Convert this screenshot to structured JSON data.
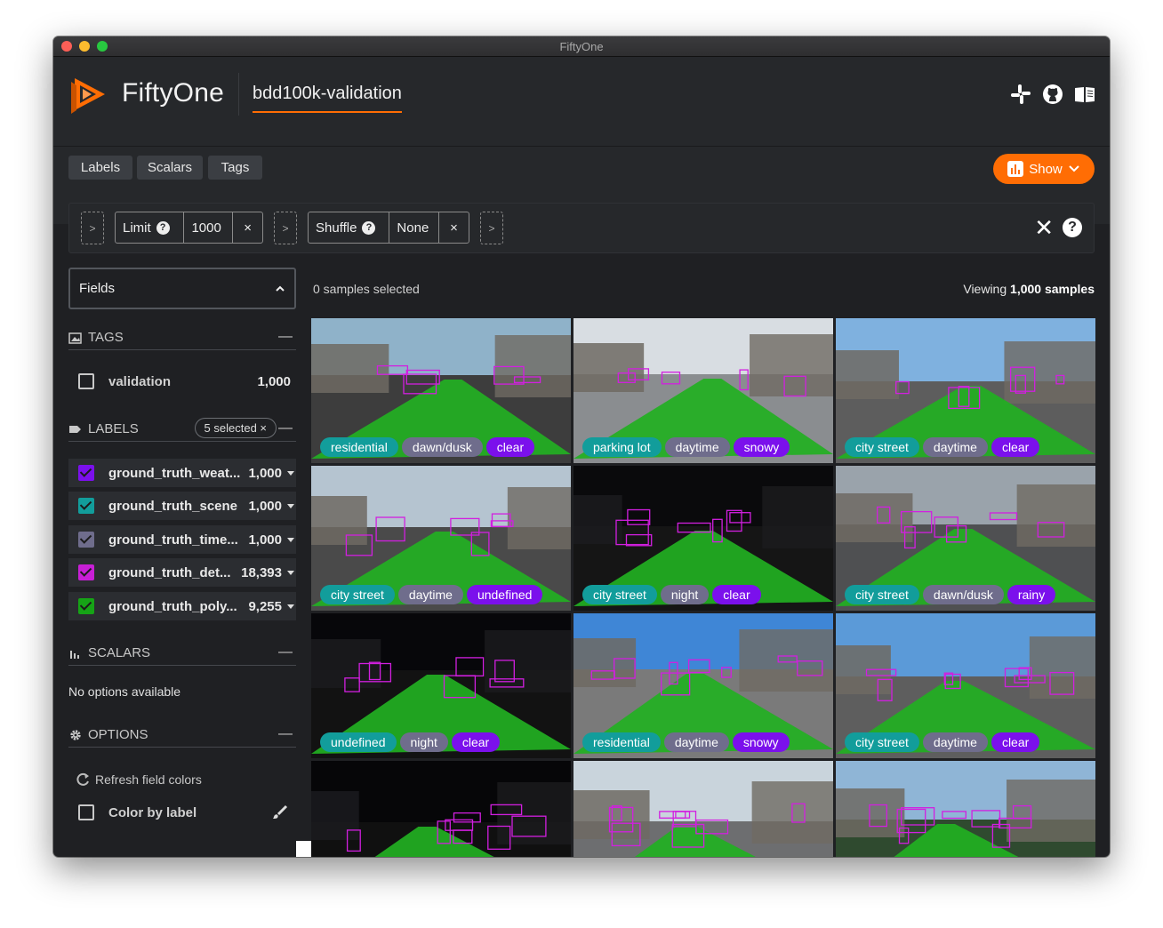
{
  "window": {
    "title": "FiftyOne"
  },
  "header": {
    "brand": "FiftyOne",
    "dataset": "bdd100k-validation",
    "icons": [
      "slack-icon",
      "github-icon",
      "docs-book-icon"
    ]
  },
  "toolbar": {
    "tabs": [
      "Labels",
      "Scalars",
      "Tags"
    ],
    "show_label": "Show"
  },
  "view_bar": {
    "stages": [
      {
        "name": "Limit",
        "value": "1000"
      },
      {
        "name": "Shuffle",
        "value": "None"
      }
    ],
    "add_glyph": ">",
    "remove_glyph": "×"
  },
  "sidebar": {
    "fields_title": "Fields",
    "tags": {
      "title": "TAGS",
      "items": [
        {
          "label": "validation",
          "count": "1,000"
        }
      ]
    },
    "labels": {
      "title": "LABELS",
      "selected_pill": "5 selected ×",
      "items": [
        {
          "label": "ground_truth_weat...",
          "count": "1,000",
          "color": "#7b10ec"
        },
        {
          "label": "ground_truth_scene",
          "count": "1,000",
          "color": "#129d9b"
        },
        {
          "label": "ground_truth_time...",
          "count": "1,000",
          "color": "#6f6d8c"
        },
        {
          "label": "ground_truth_det...",
          "count": "18,393",
          "color": "#c81fd6"
        },
        {
          "label": "ground_truth_poly...",
          "count": "9,255",
          "color": "#16a316"
        }
      ]
    },
    "scalars": {
      "title": "SCALARS",
      "empty": "No options available"
    },
    "options": {
      "title": "OPTIONS",
      "refresh": "Refresh field colors",
      "color_by_label": "Color by label"
    }
  },
  "main": {
    "selected_text": "0 samples selected",
    "viewing_prefix": "Viewing ",
    "viewing_count": "1,000 samples",
    "tiles": [
      {
        "scene": "residential",
        "time": "dawn/dusk",
        "weather": "clear",
        "sky": "#8fb2c9",
        "ground": "#3d3d3d",
        "dark": false
      },
      {
        "scene": "parking lot",
        "time": "daytime",
        "weather": "snowy",
        "sky": "#d8dde2",
        "ground": "#8a8d90",
        "dark": false
      },
      {
        "scene": "city street",
        "time": "daytime",
        "weather": "clear",
        "sky": "#7fb1df",
        "ground": "#5d5d5d",
        "dark": false
      },
      {
        "scene": "city street",
        "time": "daytime",
        "weather": "undefined",
        "sky": "#b5c4d0",
        "ground": "#4a4a4a",
        "dark": false
      },
      {
        "scene": "city street",
        "time": "night",
        "weather": "clear",
        "sky": "#0a0a0c",
        "ground": "#151515",
        "dark": true
      },
      {
        "scene": "city street",
        "time": "dawn/dusk",
        "weather": "rainy",
        "sky": "#9aa3ab",
        "ground": "#4f5052",
        "dark": false
      },
      {
        "scene": "undefined",
        "time": "night",
        "weather": "clear",
        "sky": "#07070a",
        "ground": "#121212",
        "dark": true
      },
      {
        "scene": "residential",
        "time": "daytime",
        "weather": "snowy",
        "sky": "#3f86d6",
        "ground": "#7a7a7a",
        "dark": false
      },
      {
        "scene": "city street",
        "time": "daytime",
        "weather": "clear",
        "sky": "#5b9ad8",
        "ground": "#5e5e5e",
        "dark": false
      },
      {
        "scene": "",
        "time": "",
        "weather": "",
        "sky": "#060608",
        "ground": "#101010",
        "dark": true
      },
      {
        "scene": "",
        "time": "",
        "weather": "",
        "sky": "#c9d4dc",
        "ground": "#6d6e70",
        "dark": false
      },
      {
        "scene": "",
        "time": "",
        "weather": "",
        "sky": "#8fb5d6",
        "ground": "#2f4a2f",
        "dark": false
      }
    ]
  },
  "colors": {
    "accent": "#ff6d04",
    "bg": "#1f2023",
    "panel": "#26282b",
    "detection": "#c81fd6",
    "polyline": "#16a316"
  }
}
